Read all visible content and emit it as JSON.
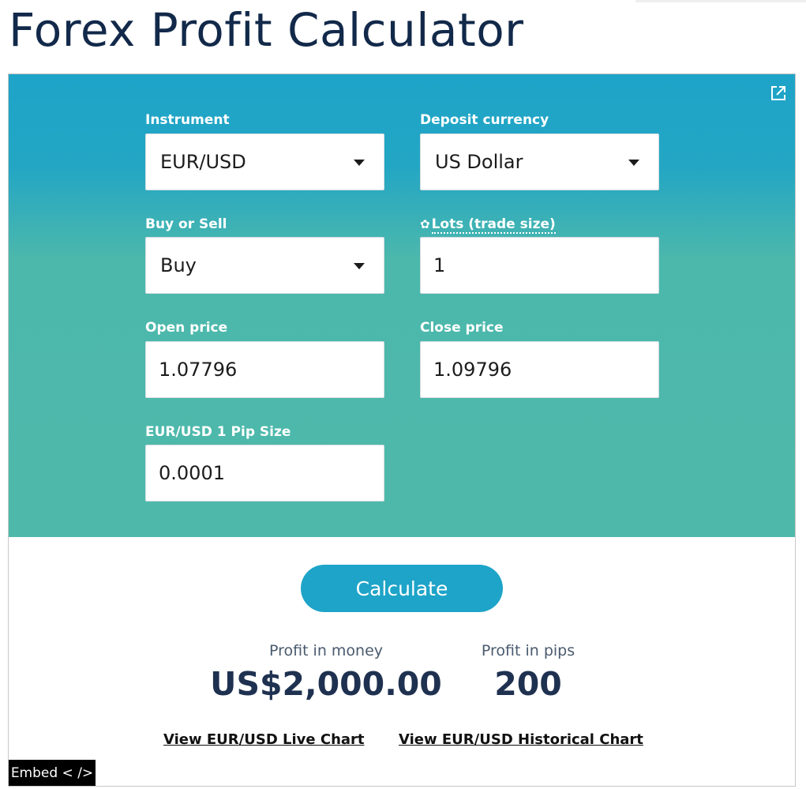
{
  "page": {
    "title": "Forex Profit Calculator"
  },
  "form": {
    "instrument": {
      "label": "Instrument",
      "value": "EUR/USD"
    },
    "deposit_currency": {
      "label": "Deposit currency",
      "value": "US Dollar"
    },
    "buy_or_sell": {
      "label": "Buy or Sell",
      "value": "Buy"
    },
    "lots": {
      "label": "Lots (trade size)",
      "value": "1"
    },
    "open_price": {
      "label": "Open price",
      "value": "1.07796"
    },
    "close_price": {
      "label": "Close price",
      "value": "1.09796"
    },
    "pip_size": {
      "label": "EUR/USD 1 Pip Size",
      "value": "0.0001"
    }
  },
  "calculate_label": "Calculate",
  "results": {
    "money": {
      "label": "Profit in money",
      "value": "US$2,000.00"
    },
    "pips": {
      "label": "Profit in pips",
      "value": "200"
    }
  },
  "links": {
    "live_chart": "View EUR/USD Live Chart",
    "historical_chart": "View EUR/USD Historical Chart"
  },
  "embed_label": "Embed < />",
  "icons": {
    "popout": "external-link-icon",
    "lots_settings": "gear-icon",
    "dropdown": "caret-down-icon"
  },
  "colors": {
    "title": "#12294a",
    "panel_top": "#1ea4c8",
    "panel_bottom": "#4eb9aa",
    "button": "#1ea4c8",
    "result_text": "#1f3150"
  }
}
